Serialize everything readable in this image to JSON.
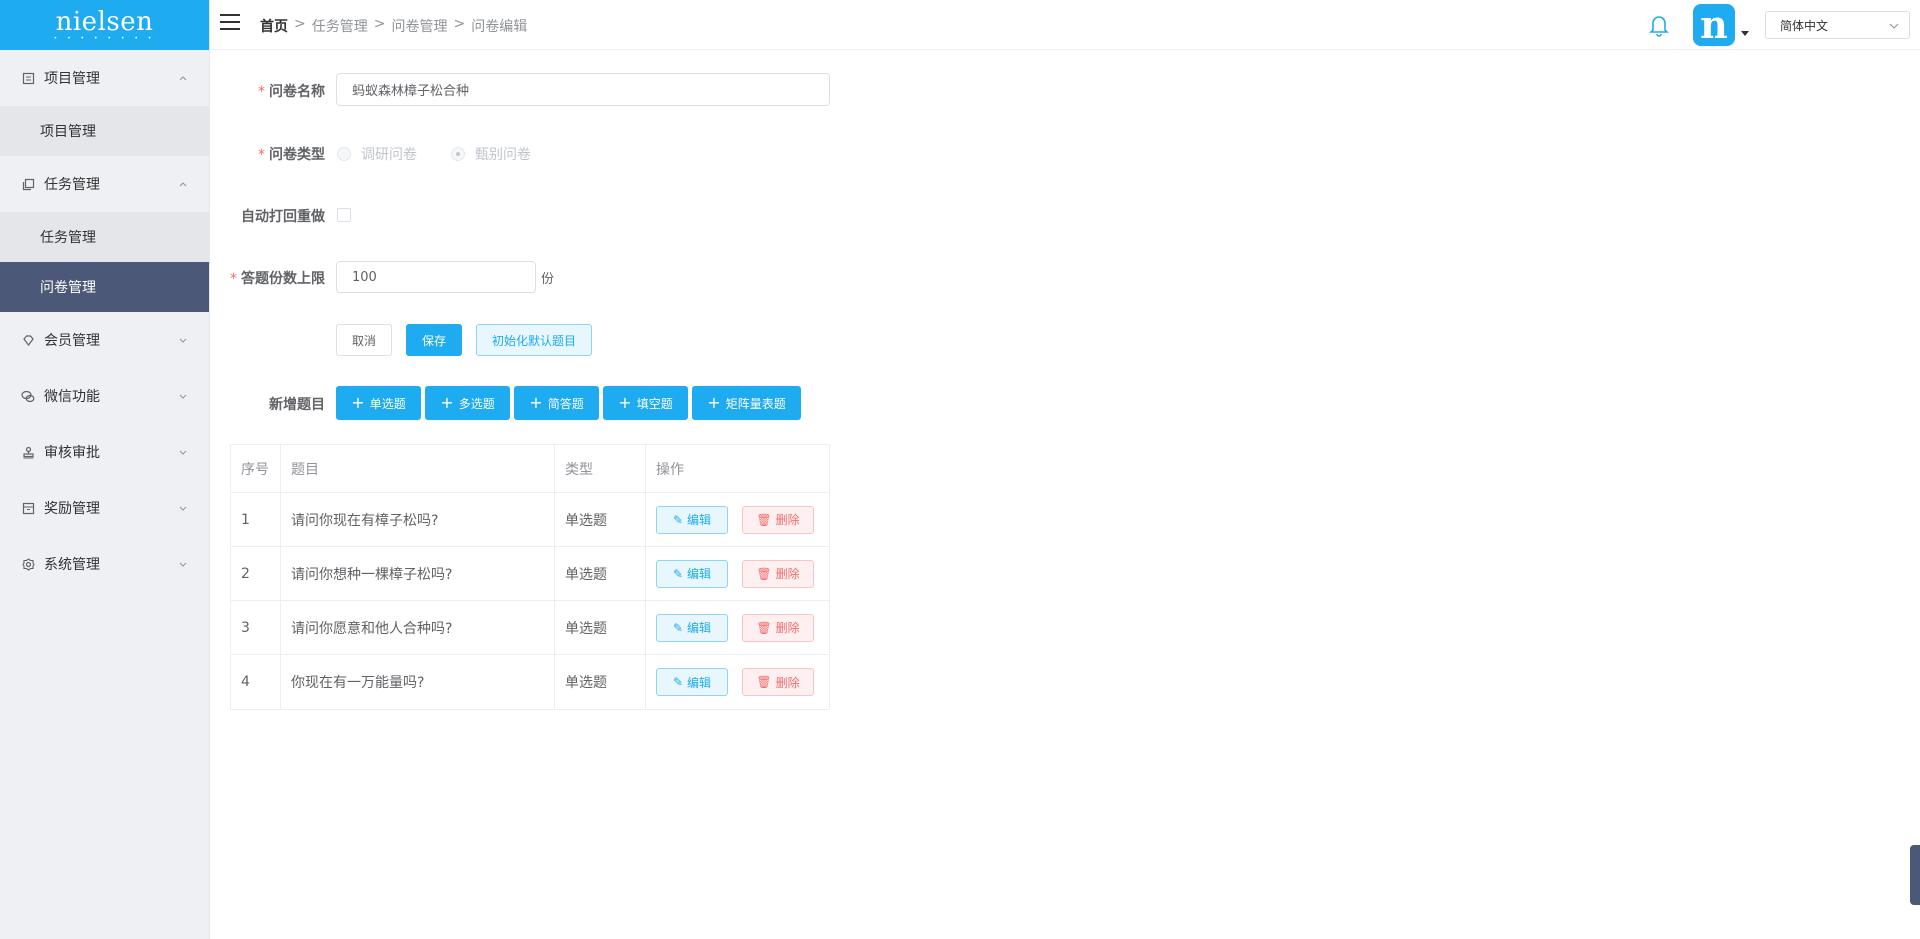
{
  "brand": {
    "logo_text": "nielsen",
    "logo_dots": "• • • • • • • •",
    "avatar_letter": "n"
  },
  "colors": {
    "accent": "#1eabf0",
    "sidebar_active": "#4b5877",
    "danger": "#f56c6c"
  },
  "sidebar": {
    "groups": [
      {
        "label": "项目管理",
        "icon": "document-icon",
        "expanded": true,
        "children": [
          {
            "label": "项目管理",
            "active": false
          }
        ]
      },
      {
        "label": "任务管理",
        "icon": "copy-icon",
        "expanded": true,
        "children": [
          {
            "label": "任务管理",
            "active": false
          },
          {
            "label": "问卷管理",
            "active": true
          }
        ]
      },
      {
        "label": "会员管理",
        "icon": "diamond-icon",
        "expanded": false
      },
      {
        "label": "微信功能",
        "icon": "chat-icon",
        "expanded": false
      },
      {
        "label": "审核审批",
        "icon": "stamp-icon",
        "expanded": false
      },
      {
        "label": "奖励管理",
        "icon": "box-icon",
        "expanded": false
      },
      {
        "label": "系统管理",
        "icon": "gear-icon",
        "expanded": false
      }
    ]
  },
  "header": {
    "breadcrumb": {
      "home": "首页",
      "sep": ">",
      "items": [
        "任务管理",
        "问卷管理",
        "问卷编辑"
      ]
    },
    "language": "简体中文"
  },
  "form": {
    "name_label": "问卷名称",
    "name_value": "蚂蚁森林樟子松合种",
    "type_label": "问卷类型",
    "type_options": [
      "调研问卷",
      "甄别问卷"
    ],
    "type_selected": "甄别问卷",
    "auto_label": "自动打回重做",
    "limit_label": "答题份数上限",
    "limit_value": "100",
    "limit_unit": "份",
    "cancel_label": "取消",
    "save_label": "保存",
    "init_label": "初始化默认题目",
    "add_label": "新增题目",
    "add_buttons": [
      "单选题",
      "多选题",
      "简答题",
      "填空题",
      "矩阵量表题"
    ]
  },
  "table": {
    "headers": [
      "序号",
      "题目",
      "类型",
      "操作"
    ],
    "edit_label": "编辑",
    "delete_label": "删除",
    "rows": [
      {
        "index": "1",
        "title": "请问你现在有樟子松吗?",
        "type": "单选题"
      },
      {
        "index": "2",
        "title": "请问你想种一棵樟子松吗?",
        "type": "单选题"
      },
      {
        "index": "3",
        "title": "请问你愿意和他人合种吗?",
        "type": "单选题"
      },
      {
        "index": "4",
        "title": "你现在有一万能量吗?",
        "type": "单选题"
      }
    ]
  }
}
